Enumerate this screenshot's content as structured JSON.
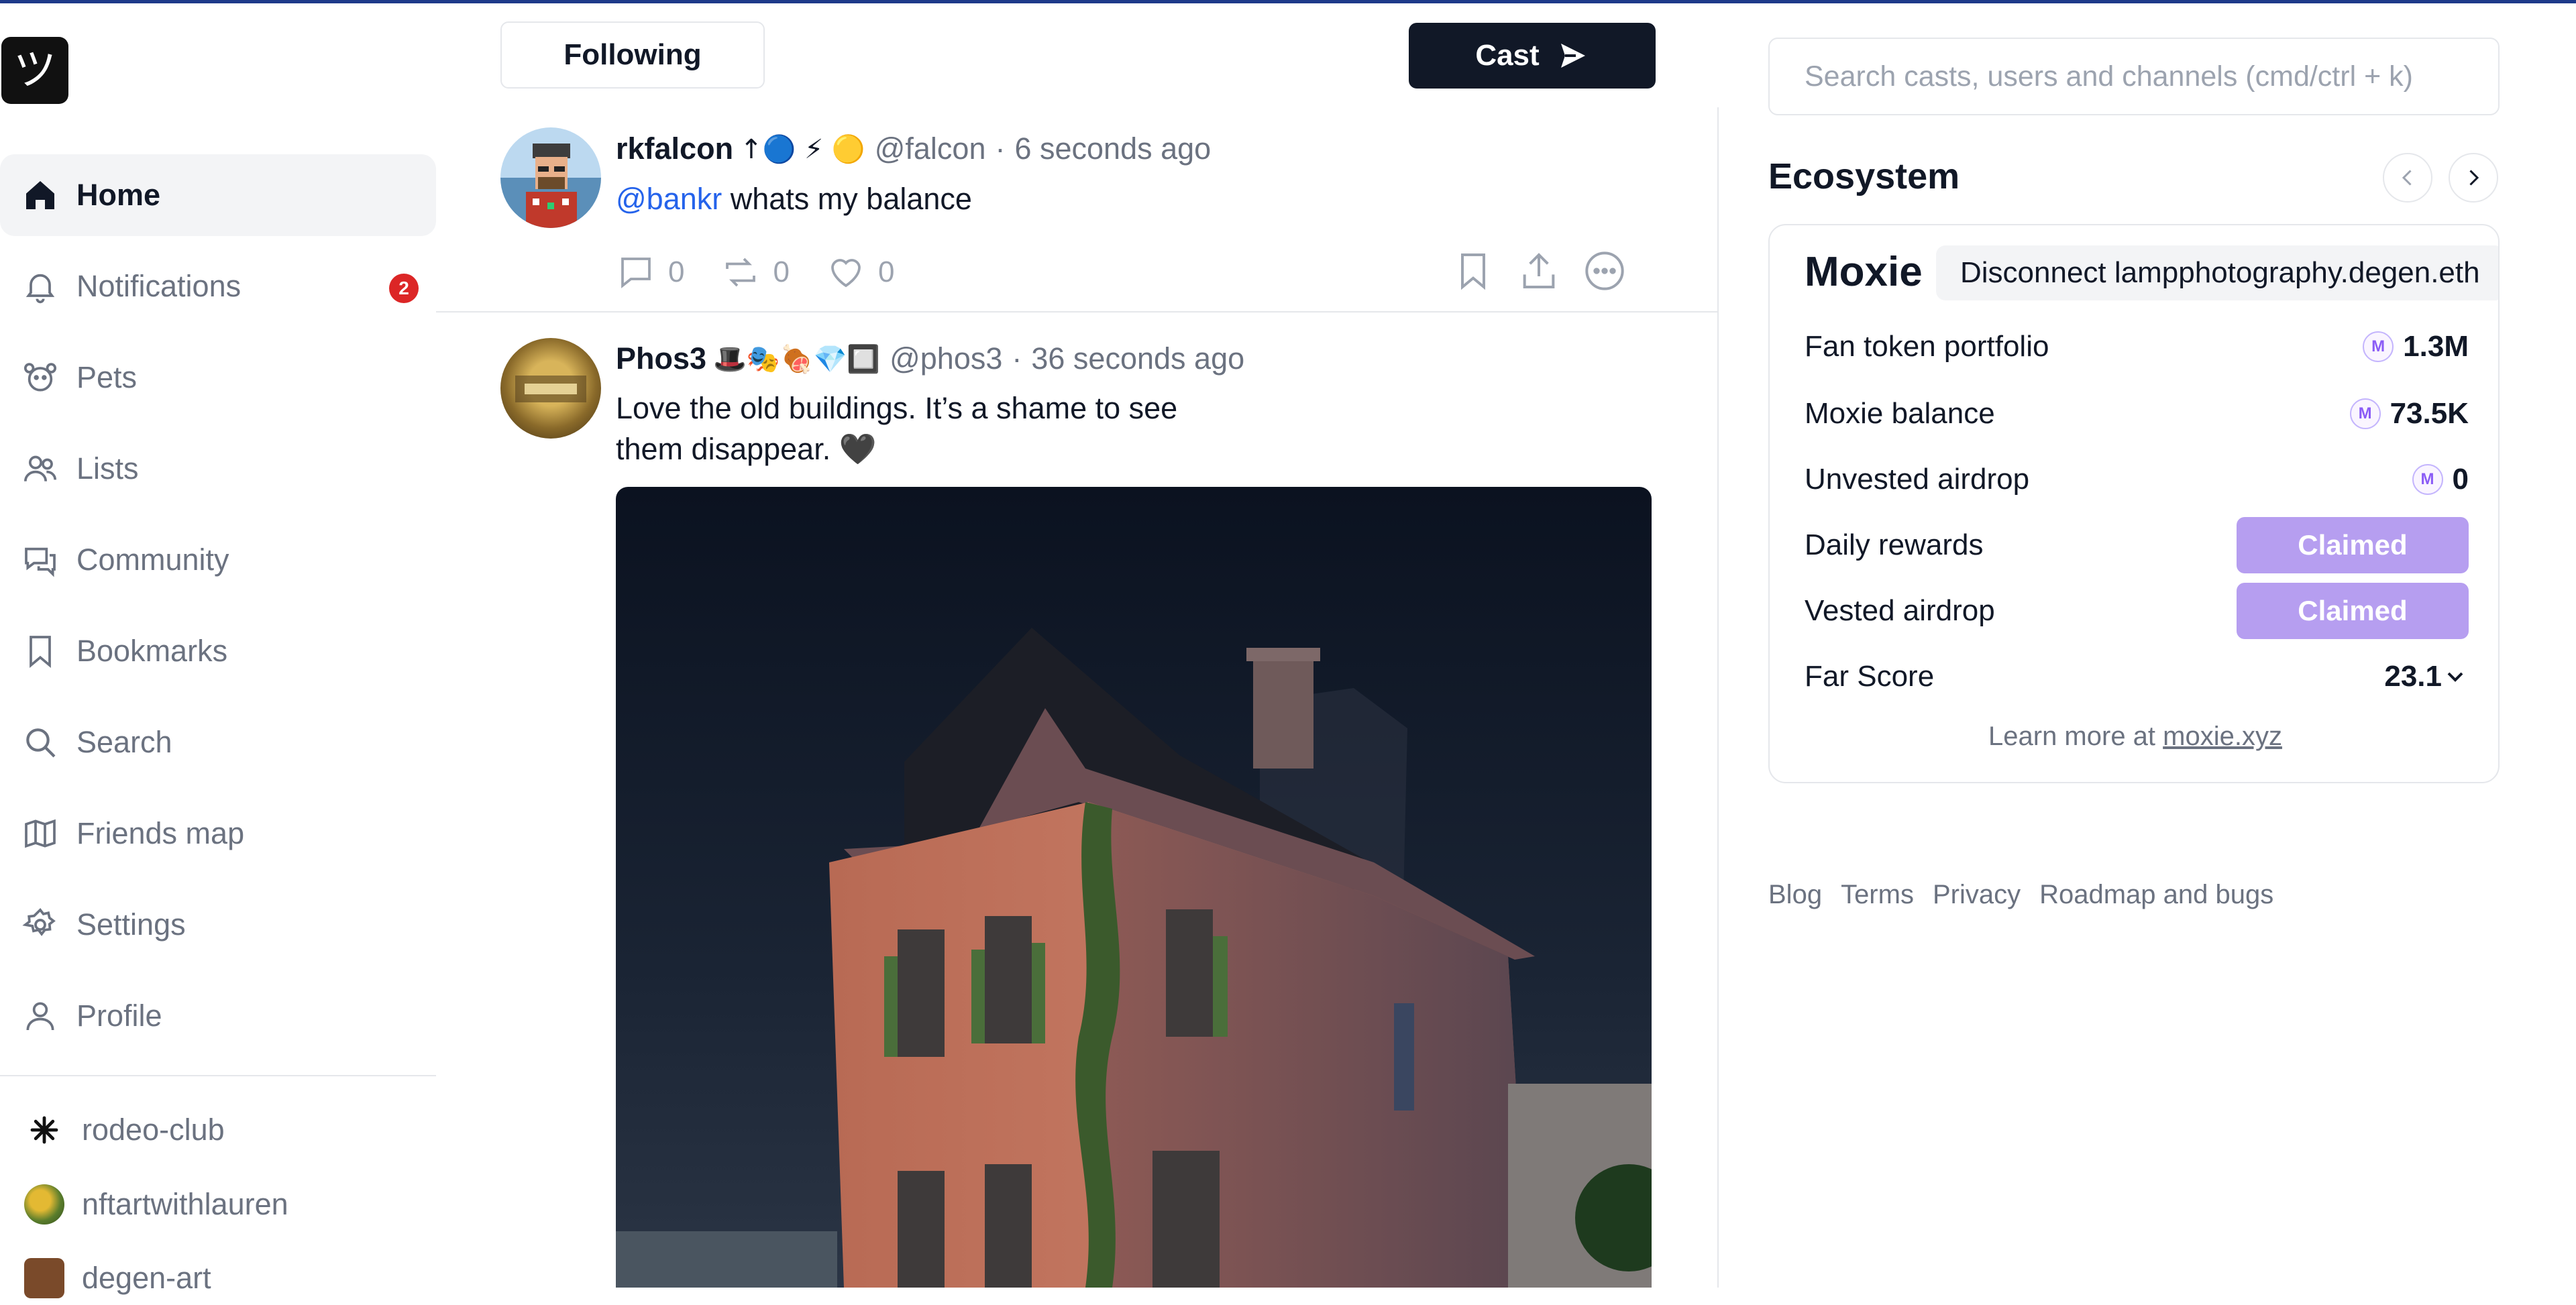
{
  "sidebar": {
    "logo_glyph": "ツ",
    "nav": [
      {
        "label": "Home",
        "icon": "home-icon",
        "active": true
      },
      {
        "label": "Notifications",
        "icon": "bell-icon",
        "badge": "2"
      },
      {
        "label": "Pets",
        "icon": "paw-icon"
      },
      {
        "label": "Lists",
        "icon": "users-icon"
      },
      {
        "label": "Community",
        "icon": "chat-bubbles-icon"
      },
      {
        "label": "Bookmarks",
        "icon": "bookmark-icon"
      },
      {
        "label": "Search",
        "icon": "search-icon"
      },
      {
        "label": "Friends map",
        "icon": "map-icon"
      },
      {
        "label": "Settings",
        "icon": "gear-icon"
      },
      {
        "label": "Profile",
        "icon": "user-icon"
      }
    ],
    "channels": [
      {
        "label": "rodeo-club"
      },
      {
        "label": "nftartwithlauren"
      },
      {
        "label": "degen-art"
      }
    ]
  },
  "feed": {
    "following_label": "Following",
    "cast_label": "Cast",
    "posts": [
      {
        "name": "rkfalcon",
        "name_emojis": "↑🔵 ⚡ 🟡",
        "handle": "@falcon",
        "time": "6 seconds ago",
        "mention": "@bankr",
        "text": " whats my balance",
        "replies": "0",
        "recasts": "0",
        "likes": "0"
      },
      {
        "name": "Phos3",
        "name_emojis": "🎩🎭🍖💎🔲",
        "handle": "@phos3",
        "time": "36 seconds ago",
        "text_line1": "Love the old buildings. It’s a shame to see",
        "text_line2": "them disappear. 🖤"
      }
    ]
  },
  "right": {
    "search_placeholder": "Search casts, users and channels (cmd/ctrl + k)",
    "ecosystem_title": "Ecosystem",
    "card": {
      "title": "Moxie",
      "disconnect_label": "Disconnect lampphotography.degen.eth",
      "coin_glyph": "M",
      "rows": [
        {
          "label": "Fan token portfolio",
          "value": "1.3M"
        },
        {
          "label": "Moxie balance",
          "value": "73.5K"
        },
        {
          "label": "Unvested airdrop",
          "value": "0"
        },
        {
          "label": "Daily rewards",
          "button": "Claimed"
        },
        {
          "label": "Vested airdrop",
          "button": "Claimed"
        },
        {
          "label": "Far Score",
          "value": "23.1"
        }
      ],
      "learn_prefix": "Learn more at ",
      "learn_link": "moxie.xyz"
    },
    "footer_links": [
      "Blog",
      "Terms",
      "Privacy",
      "Roadmap and bugs"
    ]
  },
  "colors": {
    "accent_dark": "#111827",
    "claimed_purple": "#b69ef0",
    "badge_red": "#dc2626",
    "link_blue": "#2563eb"
  }
}
